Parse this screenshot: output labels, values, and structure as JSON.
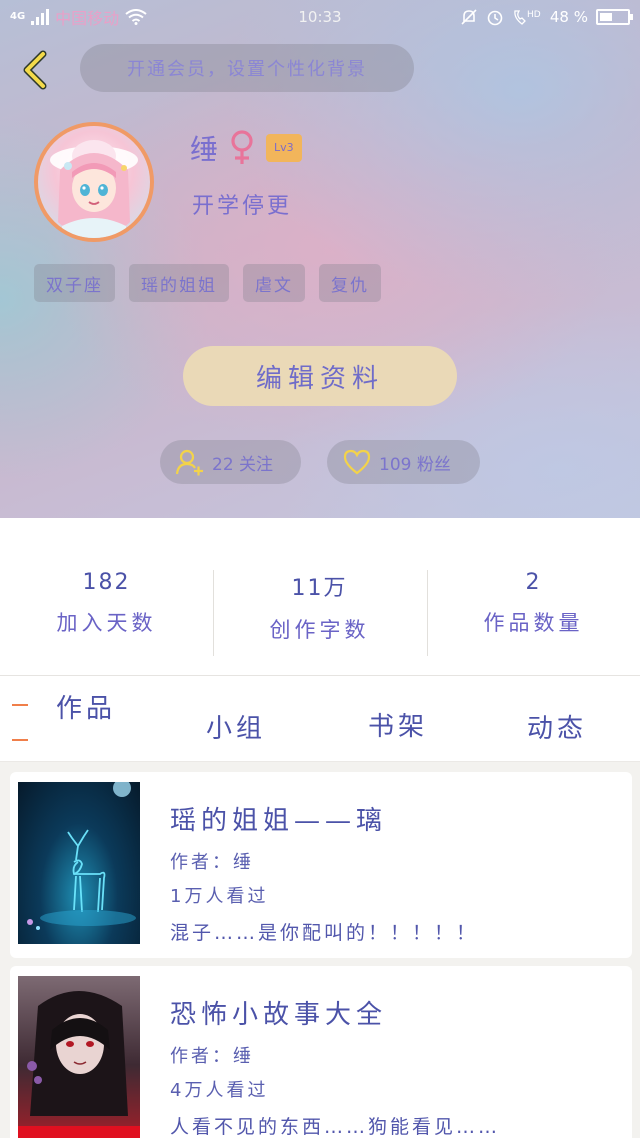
{
  "status_bar": {
    "network": "4G",
    "carrier": "中国移动",
    "time": "10:33",
    "hd_label": "HD",
    "battery": "48 %",
    "battery_level": 0.48
  },
  "header": {
    "vip_banner": "开通会员，设置个性化背景"
  },
  "profile": {
    "name": "缍",
    "gender_symbol": "♀",
    "level": "Lv3",
    "signature": "开学停更",
    "tags": [
      "双子座",
      "瑶的姐姐",
      "虐文",
      "复仇"
    ],
    "edit_label": "编辑资料",
    "following": "22 关注",
    "fans": "109 粉丝"
  },
  "stats": [
    {
      "value": "182",
      "label": "加入天数"
    },
    {
      "value": "11万",
      "label": "创作字数"
    },
    {
      "value": "2",
      "label": "作品数量"
    }
  ],
  "tabs": [
    "作品",
    "小组",
    "书架",
    "动态"
  ],
  "works": [
    {
      "title": "瑶的姐姐——璃",
      "author": "作者：缍",
      "views": "1万人看过",
      "desc": "混子……是你配叫的！！！！！"
    },
    {
      "title": "恐怖小故事大全",
      "author": "作者：缍",
      "views": "4万人看过",
      "desc": "人看不见的东西……狗能看见……"
    }
  ],
  "colors": {
    "accent_text": "#4b52a8",
    "edit_button": "#ead9b7",
    "level_badge": "#f2b55b",
    "avatar_ring": "#f09a66",
    "tab_indicator": "#f07f4a"
  }
}
